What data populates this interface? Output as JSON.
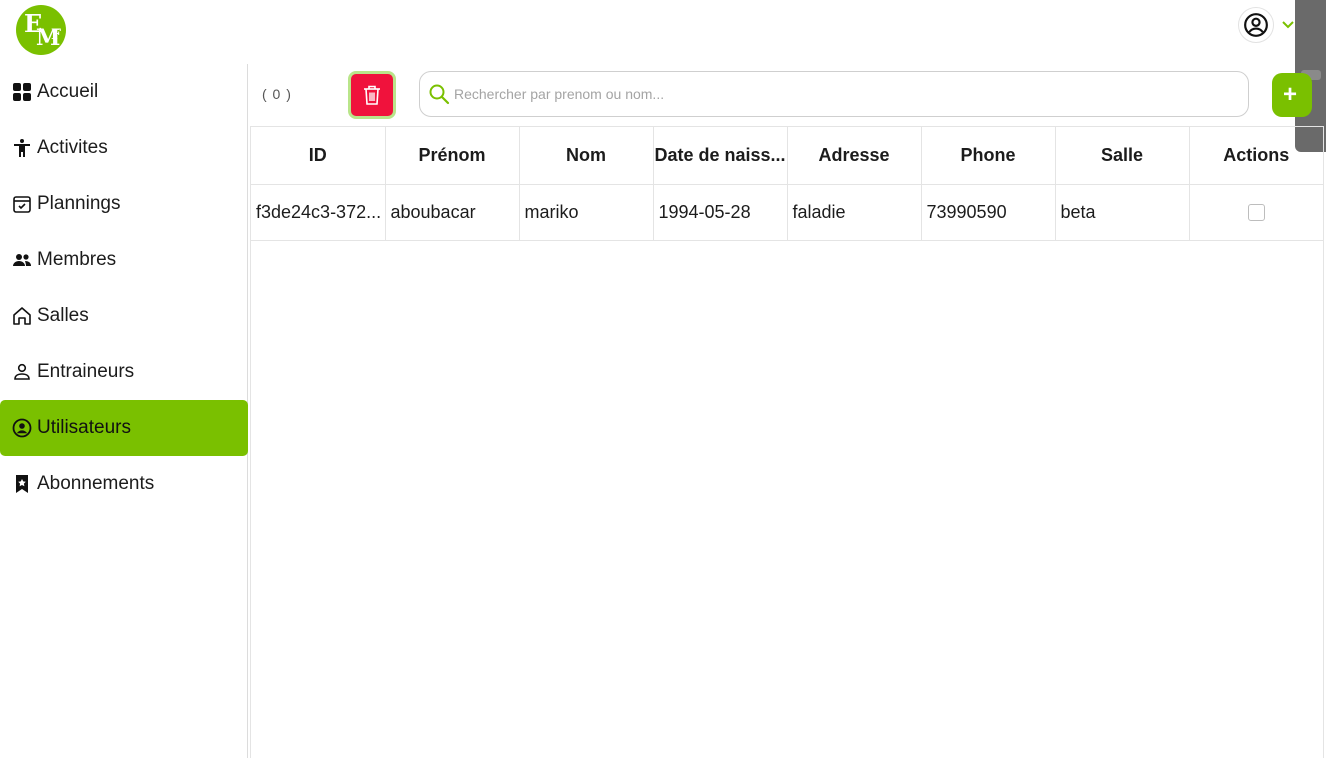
{
  "header": {
    "logo": "EMF",
    "logo_parts": [
      "E",
      "M",
      "F"
    ]
  },
  "sidebar": {
    "items": [
      {
        "label": "Accueil",
        "icon": "dashboard-grid-icon"
      },
      {
        "label": "Activites",
        "icon": "accessibility-person-icon"
      },
      {
        "label": "Plannings",
        "icon": "calendar-check-icon"
      },
      {
        "label": "Membres",
        "icon": "group-people-icon"
      },
      {
        "label": "Salles",
        "icon": "home-icon"
      },
      {
        "label": "Entraineurs",
        "icon": "person-outline-icon"
      },
      {
        "label": "Utilisateurs",
        "icon": "account-circle-icon",
        "active": true
      },
      {
        "label": "Abonnements",
        "icon": "bookmark-star-icon"
      }
    ]
  },
  "toolbar": {
    "count": "( 0 )",
    "search_placeholder": "Rechercher par prenom ou nom...",
    "add_label": "+"
  },
  "table": {
    "columns": [
      "ID",
      "Prénom",
      "Nom",
      "Date de naiss...",
      "Adresse",
      "Phone",
      "Salle",
      "Actions"
    ],
    "rows": [
      {
        "id": "f3de24c3-372...",
        "prenom": "aboubacar",
        "nom": "mariko",
        "date": "1994-05-28",
        "adresse": "faladie",
        "phone": "73990590",
        "salle": "beta",
        "selected": false
      }
    ]
  },
  "colors": {
    "accent": "#7ac000",
    "danger": "#f0123c"
  }
}
